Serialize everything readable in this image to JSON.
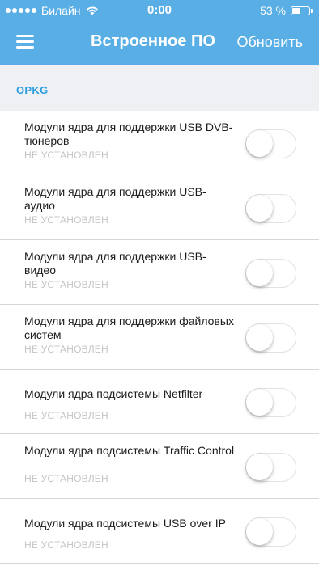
{
  "status_bar": {
    "carrier": "Билайн",
    "time": "0:00",
    "battery": "53 %",
    "battery_level": 0.53
  },
  "nav": {
    "title": "Встроенное ПО",
    "update_label": "Обновить"
  },
  "section": {
    "title": "OPKG"
  },
  "modules": [
    {
      "name": "Модули ядра для поддержки USB DVB-тюнеров",
      "status": "НЕ УСТАНОВЛЕН",
      "enabled": false
    },
    {
      "name": "Модули ядра для поддержки USB-аудио",
      "status": "НЕ УСТАНОВЛЕН",
      "enabled": false
    },
    {
      "name": "Модули ядра для поддержки USB-видео",
      "status": "НЕ УСТАНОВЛЕН",
      "enabled": false
    },
    {
      "name": "Модули ядра для поддержки файловых систем",
      "status": "НЕ УСТАНОВЛЕН",
      "enabled": false
    },
    {
      "name": "Модули ядра подсистемы Netfilter",
      "status": "НЕ УСТАНОВЛЕН",
      "enabled": false
    },
    {
      "name": "Модули ядра подсистемы Traffic Control",
      "status": "НЕ УСТАНОВЛЕН",
      "enabled": false
    },
    {
      "name": "Модули ядра подсистемы USB over IP",
      "status": "НЕ УСТАНОВЛЕН",
      "enabled": false
    }
  ],
  "colors": {
    "header_bg": "#5aaee6",
    "section_title": "#2c9de0",
    "status_text": "#c5c5c9"
  }
}
